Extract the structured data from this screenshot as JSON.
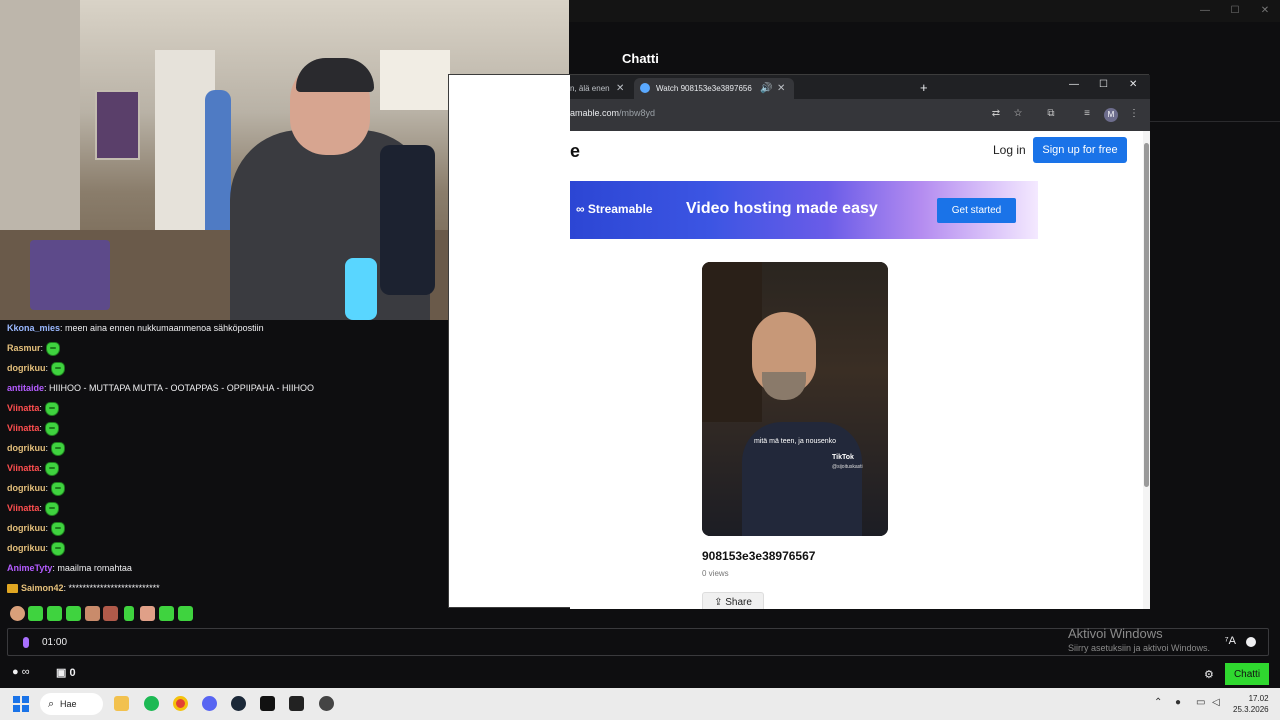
{
  "app": {
    "title": "Chatti",
    "window_controls": [
      "—",
      "☐",
      "✕"
    ]
  },
  "chat": {
    "messages": [
      {
        "user": "Kkona_mies",
        "color": "#9ab8ff",
        "text": ": meen aina ennen nukkumaanmenoa sähköpostiin",
        "emote": false
      },
      {
        "user": "Rasmur",
        "color": "#e5c07b",
        "text": ":",
        "emote": true
      },
      {
        "user": "dogrikuu",
        "color": "#e5c07b",
        "text": ":",
        "emote": true
      },
      {
        "user": "antitaide",
        "color": "#b45cff",
        "text": ": HIIHOO - MUTTAPA MUTTA - OOTAPPAS - OPPIIPAHA - HIIHOO",
        "emote": false
      },
      {
        "user": "Viinatta",
        "color": "#ff4f4f",
        "text": ":",
        "emote": true
      },
      {
        "user": "Viinatta",
        "color": "#ff4f4f",
        "text": ":",
        "emote": true
      },
      {
        "user": "dogrikuu",
        "color": "#e5c07b",
        "text": ":",
        "emote": true
      },
      {
        "user": "Viinatta",
        "color": "#ff4f4f",
        "text": ":",
        "emote": true
      },
      {
        "user": "dogrikuu",
        "color": "#e5c07b",
        "text": ":",
        "emote": true
      },
      {
        "user": "Viinatta",
        "color": "#ff4f4f",
        "text": ":",
        "emote": true
      },
      {
        "user": "dogrikuu",
        "color": "#e5c07b",
        "text": ":",
        "emote": true
      },
      {
        "user": "dogrikuu",
        "color": "#e5c07b",
        "text": ":",
        "emote": true
      },
      {
        "user": "AnimeTyty",
        "color": "#b45cff",
        "text": ": maailma romahtaa",
        "emote": false
      },
      {
        "user": "Saimon42",
        "color": "#e5c07b",
        "text": ": **************************",
        "emote": false,
        "badge": true
      }
    ],
    "input_timer": "01:00",
    "points_label": "∞",
    "store_count": "0",
    "chat_button": "Chatti"
  },
  "browser": {
    "tabs": [
      {
        "label": "n, älä enen",
        "active": false
      },
      {
        "label": "Watch 908153e3e3897656",
        "active": true
      }
    ],
    "new_tab": "+",
    "url_domain": "amable.com",
    "url_path": "/mbw8yd",
    "avatar_letter": "M",
    "page": {
      "logo_fragment": "e",
      "login": "Log in",
      "signup": "Sign up for free",
      "banner_logo": "Streamable",
      "banner_tagline": "Video hosting made easy",
      "banner_cta": "Get started",
      "video_caption": "mitä mä teen, ja nousenko",
      "video_watermark": "TikTok",
      "video_handle": "@sijoituskasti",
      "video_title": "908153e3e38976567",
      "views": "0 views",
      "share": "Share"
    }
  },
  "watermark": {
    "line1": "Aktivoi Windows",
    "line2": "Siirry asetuksiin ja aktivoi Windows."
  },
  "taskbar": {
    "search": "Hae",
    "time": "17.02",
    "date": "25.3.2026"
  }
}
